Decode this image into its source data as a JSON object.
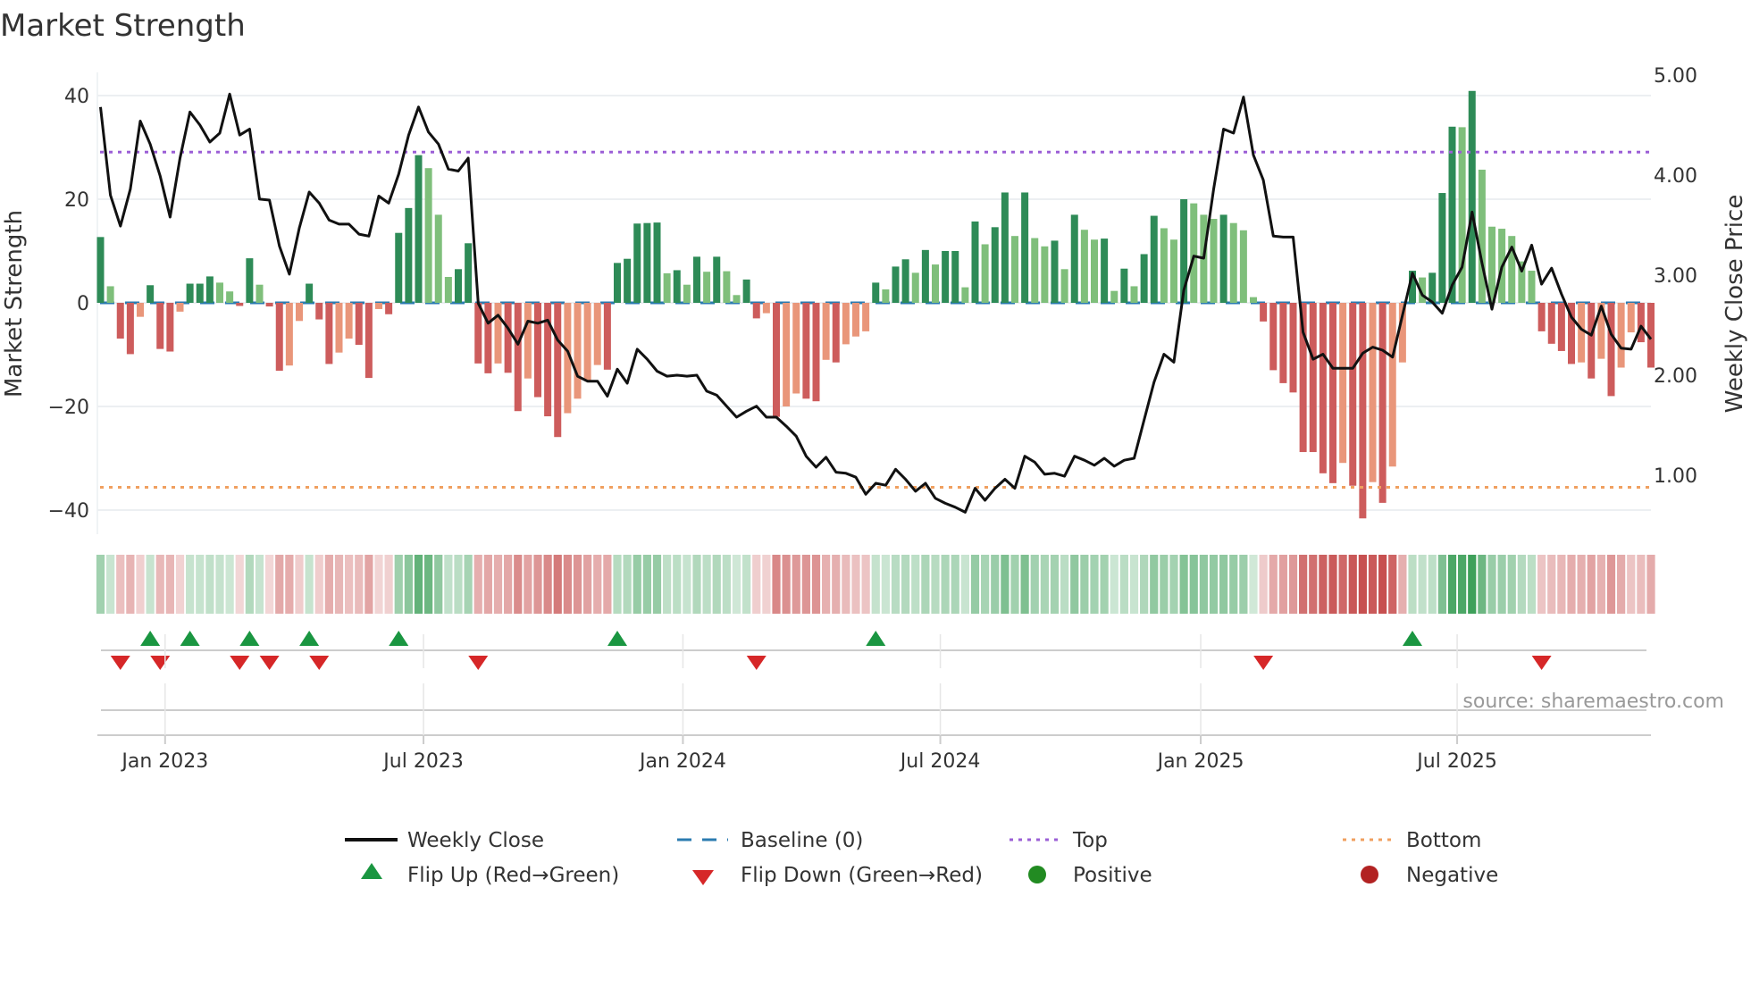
{
  "title": "Market Strength",
  "source": "source: sharemaestro.com",
  "colors": {
    "pos_strong": "#2e8b57",
    "pos_weak": "#7fbf7b",
    "neg_strong": "#cd5c5c",
    "neg_weak": "#e9967a",
    "baseline": "#2b7bb0",
    "top": "#9b5fd6",
    "bottom": "#f0a060",
    "flip_up": "#1a9641",
    "flip_down": "#d62728",
    "positive": "#228b22",
    "negative": "#b22222",
    "close": "#111111"
  },
  "legend": {
    "weekly_close": "Weekly Close",
    "baseline": "Baseline (0)",
    "top": "Top",
    "bottom": "Bottom",
    "flip_up": "Flip Up (Red→Green)",
    "flip_down": "Flip Down (Green→Red)",
    "positive": "Positive",
    "negative": "Negative"
  },
  "chart_data": {
    "type": "bar+line",
    "title": "Market Strength",
    "ylabel": "Market Strength",
    "y2label": "Weekly Close Price",
    "ylim": [
      -45,
      45
    ],
    "y2lim": [
      0.48,
      5.5
    ],
    "yticks": [
      {
        "v": 40,
        "label": "40"
      },
      {
        "v": 20,
        "label": "20"
      },
      {
        "v": 0,
        "label": "0"
      },
      {
        "v": -20,
        "label": "−20"
      },
      {
        "v": -40,
        "label": "−40"
      }
    ],
    "y2ticks": [
      {
        "v": 5,
        "label": "5.00"
      },
      {
        "v": 4,
        "label": "4.00"
      },
      {
        "v": 3,
        "label": "3.00"
      },
      {
        "v": 2,
        "label": "2.00"
      },
      {
        "v": 1,
        "label": "1.00"
      }
    ],
    "xticks": [
      {
        "week": 6.5,
        "label": "Jan 2023"
      },
      {
        "week": 32.5,
        "label": "Jul 2023"
      },
      {
        "week": 58.6,
        "label": "Jan 2024"
      },
      {
        "week": 84.5,
        "label": "Jul 2024"
      },
      {
        "week": 110.7,
        "label": "Jan 2025"
      },
      {
        "week": 136.5,
        "label": "Jul 2025"
      }
    ],
    "top_level": 29.1,
    "bottom_level": -35.6,
    "baseline": 0,
    "strength": [
      12.7,
      3.2,
      -6.9,
      -9.9,
      -2.7,
      3.4,
      -8.9,
      -9.4,
      -1.7,
      3.7,
      3.7,
      5.1,
      3.9,
      2.2,
      -0.6,
      8.6,
      3.5,
      -0.7,
      -13.1,
      -12.1,
      -3.5,
      3.7,
      -3.2,
      -11.8,
      -9.6,
      -6.9,
      -8.1,
      -14.5,
      -1.2,
      -2.2,
      13.5,
      18.3,
      28.5,
      26,
      17,
      5,
      6.5,
      11.5,
      -11.7,
      -13.6,
      -11.7,
      -13.5,
      -20.9,
      -14.6,
      -18.2,
      -21.9,
      -25.9,
      -21.3,
      -18.5,
      -15,
      -12,
      -12.9,
      7.7,
      8.5,
      15.3,
      15.4,
      15.5,
      5.7,
      6.3,
      3.5,
      8.9,
      6,
      8.9,
      6.1,
      1.5,
      4.5,
      -3,
      -2,
      -22,
      -20,
      -17.5,
      -18.5,
      -19,
      -11,
      -11.5,
      -8,
      -6.5,
      -5.5,
      3.9,
      2.6,
      7,
      8.4,
      5.8,
      10.2,
      7.4,
      10,
      10,
      3,
      15.7,
      11.3,
      14.6,
      21.3,
      12.9,
      21.3,
      12.5,
      10.9,
      12,
      6.5,
      17,
      14.1,
      12.2,
      12.4,
      2.3,
      6.6,
      3.2,
      9.4,
      16.8,
      14.4,
      12.2,
      20,
      19.2,
      17,
      16.2,
      17,
      15.4,
      14,
      1.1,
      -3.6,
      -13,
      -15.5,
      -17.3,
      -28.8,
      -28.8,
      -32.9,
      -34.8,
      -30.9,
      -35.3,
      -41.6,
      -34.6,
      -38.6,
      -31.6,
      -11.5,
      6.2,
      4.9,
      5.8,
      21.2,
      34,
      33.9,
      40.9,
      25.7,
      14.7,
      14.3,
      12.9,
      8,
      6.2,
      -5.5,
      -7.9,
      -9.3,
      -11.8,
      -11.5,
      -14.6,
      -10.8,
      -18,
      -12.5,
      -5.7,
      -7.6,
      -12.5
    ],
    "close": [
      4.68,
      3.8,
      3.49,
      3.86,
      4.54,
      4.31,
      3.99,
      3.58,
      4.17,
      4.63,
      4.5,
      4.33,
      4.42,
      4.81,
      4.4,
      4.46,
      3.76,
      3.75,
      3.29,
      3.01,
      3.47,
      3.83,
      3.72,
      3.55,
      3.51,
      3.51,
      3.41,
      3.39,
      3.79,
      3.72,
      4.01,
      4.4,
      4.68,
      4.43,
      4.31,
      4.06,
      4.04,
      4.17,
      2.72,
      2.52,
      2.6,
      2.47,
      2.31,
      2.54,
      2.52,
      2.55,
      2.35,
      2.24,
      1.99,
      1.94,
      1.94,
      1.79,
      2.06,
      1.92,
      2.26,
      2.16,
      2.04,
      1.99,
      2.0,
      1.99,
      2.0,
      1.84,
      1.8,
      1.69,
      1.58,
      1.64,
      1.69,
      1.58,
      1.58,
      1.49,
      1.39,
      1.19,
      1.08,
      1.18,
      1.03,
      1.02,
      0.98,
      0.81,
      0.92,
      0.9,
      1.06,
      0.96,
      0.84,
      0.92,
      0.77,
      0.72,
      0.68,
      0.63,
      0.87,
      0.75,
      0.87,
      0.96,
      0.87,
      1.19,
      1.13,
      1.01,
      1.02,
      0.99,
      1.19,
      1.15,
      1.1,
      1.17,
      1.09,
      1.15,
      1.17,
      1.55,
      1.93,
      2.21,
      2.13,
      2.85,
      3.19,
      3.17,
      3.86,
      4.46,
      4.42,
      4.78,
      4.2,
      3.95,
      3.39,
      3.38,
      3.38,
      2.43,
      2.16,
      2.21,
      2.07,
      2.07,
      2.07,
      2.22,
      2.28,
      2.25,
      2.18,
      2.6,
      3.02,
      2.8,
      2.73,
      2.62,
      2.9,
      3.08,
      3.63,
      3.12,
      2.66,
      3.08,
      3.28,
      3.04,
      3.3,
      2.91,
      3.07,
      2.81,
      2.58,
      2.46,
      2.4,
      2.69,
      2.41,
      2.27,
      2.26,
      2.49,
      2.36
    ],
    "grid": true,
    "legend_position": "bottom"
  }
}
